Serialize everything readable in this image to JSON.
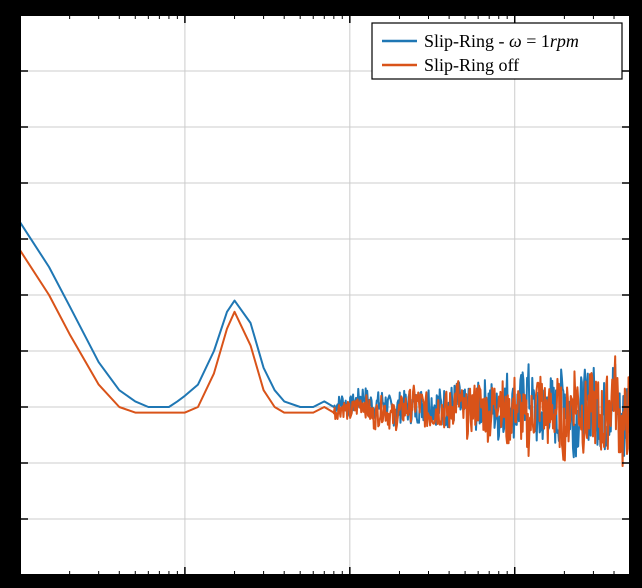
{
  "chart_data": {
    "type": "line",
    "title": "",
    "xlabel": "",
    "ylabel": "",
    "x_scale": "log",
    "xlim": [
      0.1,
      500
    ],
    "ylim": [
      0,
      1.0
    ],
    "x_ticks_major": [
      0.1,
      1,
      10,
      100
    ],
    "x_ticks_minor": [
      0.2,
      0.3,
      0.4,
      0.5,
      0.6,
      0.7,
      0.8,
      0.9,
      2,
      3,
      4,
      5,
      6,
      7,
      8,
      9,
      20,
      30,
      40,
      50,
      60,
      70,
      80,
      90,
      200,
      300,
      400,
      500
    ],
    "y_ticks_major": [
      0,
      0.1,
      0.2,
      0.3,
      0.4,
      0.5,
      0.6,
      0.7,
      0.8,
      0.9,
      1.0
    ],
    "grid_major": true,
    "legend": {
      "position": "top-right",
      "entries": [
        {
          "name": "Slip-Ring - ω = 1rpm",
          "color": "#1f77b4"
        },
        {
          "name": "Slip-Ring off",
          "color": "#d95319"
        }
      ]
    },
    "series": [
      {
        "name": "Slip-Ring - ω = 1rpm",
        "color": "#1f77b4",
        "x": [
          0.1,
          0.15,
          0.2,
          0.3,
          0.4,
          0.5,
          0.6,
          0.7,
          0.8,
          0.9,
          1.0,
          1.2,
          1.5,
          1.8,
          2.0,
          2.5,
          3.0,
          3.5,
          4.0,
          5.0,
          6.0,
          7.0,
          8.0,
          9.0,
          10,
          12,
          14,
          16,
          18,
          20,
          25,
          30,
          35,
          40,
          45,
          50,
          60,
          70,
          80,
          90,
          100,
          120,
          140,
          160,
          180,
          200,
          230,
          260,
          300,
          350,
          400,
          450,
          500
        ],
        "y": [
          0.63,
          0.55,
          0.48,
          0.38,
          0.33,
          0.31,
          0.3,
          0.3,
          0.3,
          0.31,
          0.32,
          0.34,
          0.4,
          0.47,
          0.49,
          0.45,
          0.37,
          0.33,
          0.31,
          0.3,
          0.3,
          0.31,
          0.3,
          0.31,
          0.3,
          0.32,
          0.3,
          0.31,
          0.29,
          0.3,
          0.3,
          0.31,
          0.3,
          0.3,
          0.31,
          0.29,
          0.3,
          0.31,
          0.28,
          0.32,
          0.29,
          0.33,
          0.27,
          0.31,
          0.28,
          0.33,
          0.27,
          0.3,
          0.31,
          0.28,
          0.33,
          0.26,
          0.31
        ]
      },
      {
        "name": "Slip-Ring off",
        "color": "#d95319",
        "x": [
          0.1,
          0.15,
          0.2,
          0.3,
          0.4,
          0.5,
          0.6,
          0.7,
          0.8,
          0.9,
          1.0,
          1.2,
          1.5,
          1.8,
          2.0,
          2.5,
          3.0,
          3.5,
          4.0,
          5.0,
          6.0,
          7.0,
          8.0,
          9.0,
          10,
          12,
          14,
          16,
          18,
          20,
          25,
          30,
          35,
          40,
          45,
          50,
          60,
          70,
          80,
          90,
          100,
          120,
          140,
          160,
          180,
          200,
          230,
          260,
          300,
          350,
          400,
          450,
          500
        ],
        "y": [
          0.58,
          0.5,
          0.43,
          0.34,
          0.3,
          0.29,
          0.29,
          0.29,
          0.29,
          0.29,
          0.29,
          0.3,
          0.36,
          0.44,
          0.47,
          0.41,
          0.33,
          0.3,
          0.29,
          0.29,
          0.29,
          0.3,
          0.29,
          0.3,
          0.29,
          0.31,
          0.28,
          0.3,
          0.28,
          0.29,
          0.31,
          0.29,
          0.3,
          0.29,
          0.32,
          0.28,
          0.31,
          0.28,
          0.33,
          0.27,
          0.31,
          0.26,
          0.32,
          0.28,
          0.3,
          0.26,
          0.33,
          0.28,
          0.3,
          0.27,
          0.34,
          0.25,
          0.3
        ]
      }
    ]
  }
}
